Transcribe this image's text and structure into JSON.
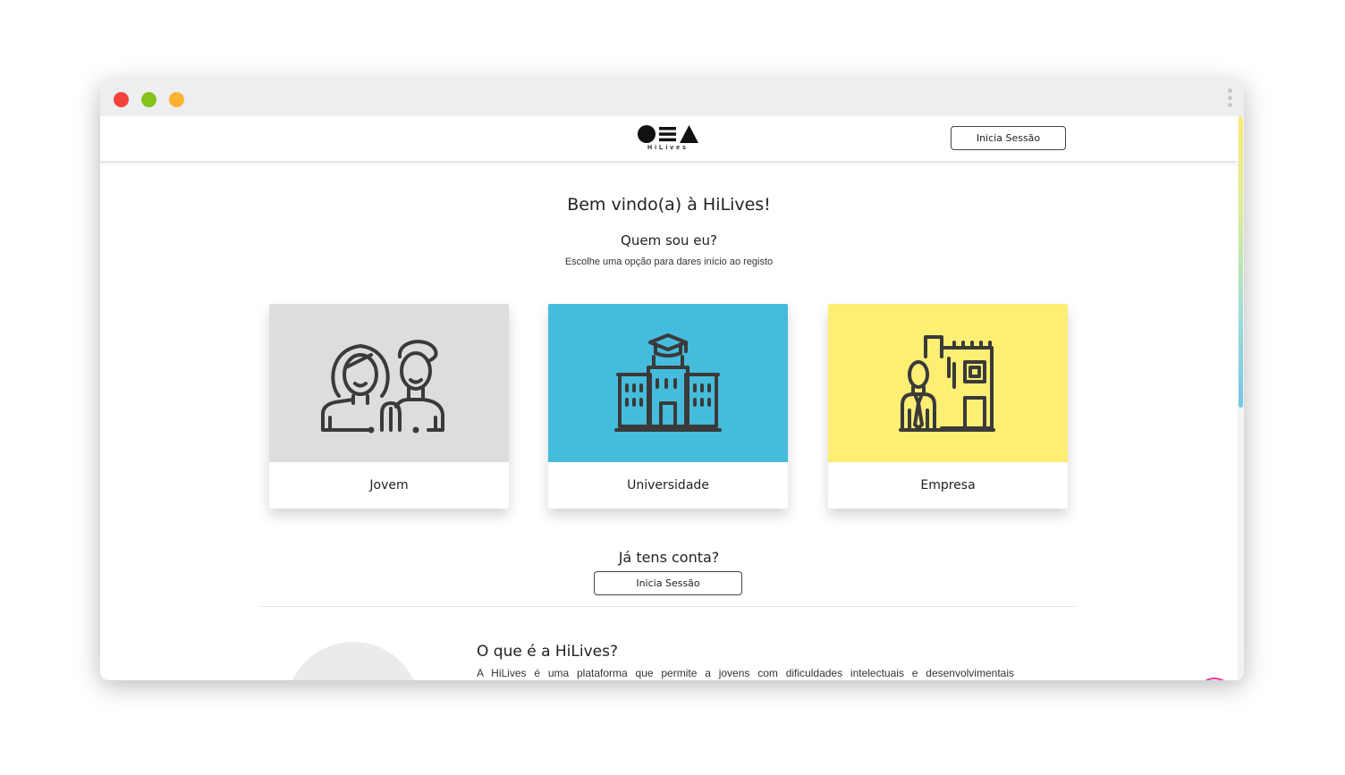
{
  "window": {
    "controls": [
      "close",
      "minimize",
      "maximize"
    ]
  },
  "header": {
    "logo_text": "HiLives",
    "login_label": "Inicia Sessão"
  },
  "intro": {
    "welcome": "Bem vindo(a) à HiLives!",
    "question": "Quem sou eu?",
    "hint": "Escolhe uma opção para dares início ao registo"
  },
  "options": [
    {
      "label": "Jovem",
      "color": "#dedddd",
      "icon": "young-people-icon"
    },
    {
      "label": "Universidade",
      "color": "#45bcdc",
      "icon": "university-building-icon"
    },
    {
      "label": "Empresa",
      "color": "#fdee74",
      "icon": "company-building-icon"
    }
  ],
  "account": {
    "question": "Já tens conta?",
    "login_label": "Inicia Sessão"
  },
  "about": {
    "title": "O que é a HiLives?",
    "text": "A HiLives é uma plataforma que permite a jovens com dificuldades intelectuais e desenvolvimentais"
  },
  "accessibility": {
    "icon": "accessibility-icon",
    "color": "#e6399b"
  }
}
